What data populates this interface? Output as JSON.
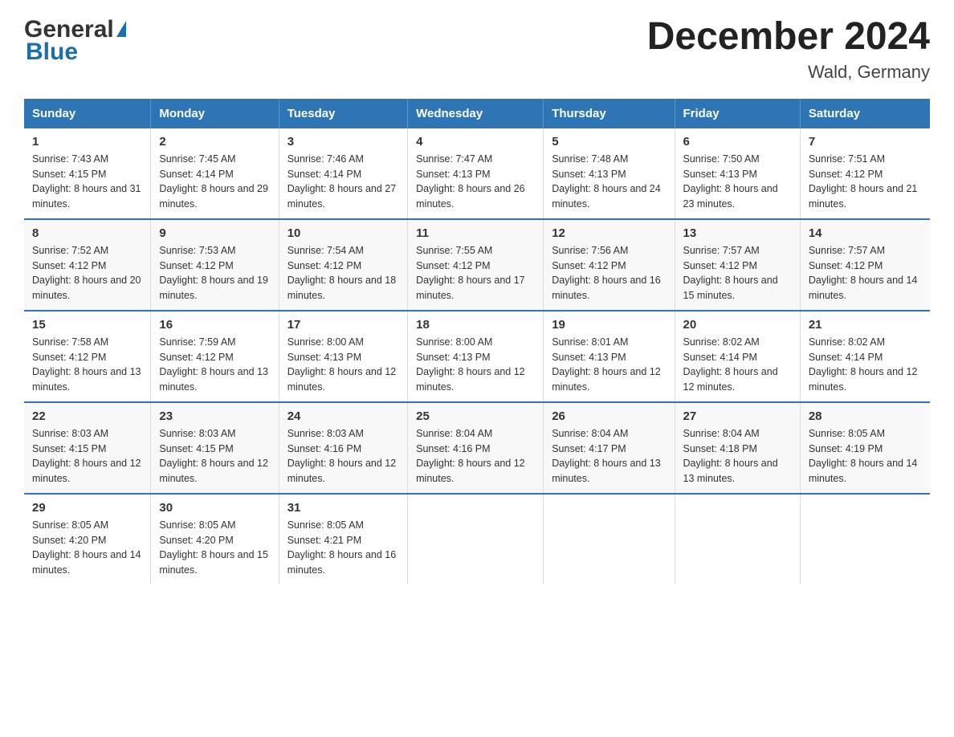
{
  "logo": {
    "general": "General",
    "blue": "Blue"
  },
  "title": "December 2024",
  "subtitle": "Wald, Germany",
  "days_of_week": [
    "Sunday",
    "Monday",
    "Tuesday",
    "Wednesday",
    "Thursday",
    "Friday",
    "Saturday"
  ],
  "weeks": [
    [
      {
        "date": "1",
        "sunrise": "7:43 AM",
        "sunset": "4:15 PM",
        "daylight": "8 hours and 31 minutes."
      },
      {
        "date": "2",
        "sunrise": "7:45 AM",
        "sunset": "4:14 PM",
        "daylight": "8 hours and 29 minutes."
      },
      {
        "date": "3",
        "sunrise": "7:46 AM",
        "sunset": "4:14 PM",
        "daylight": "8 hours and 27 minutes."
      },
      {
        "date": "4",
        "sunrise": "7:47 AM",
        "sunset": "4:13 PM",
        "daylight": "8 hours and 26 minutes."
      },
      {
        "date": "5",
        "sunrise": "7:48 AM",
        "sunset": "4:13 PM",
        "daylight": "8 hours and 24 minutes."
      },
      {
        "date": "6",
        "sunrise": "7:50 AM",
        "sunset": "4:13 PM",
        "daylight": "8 hours and 23 minutes."
      },
      {
        "date": "7",
        "sunrise": "7:51 AM",
        "sunset": "4:12 PM",
        "daylight": "8 hours and 21 minutes."
      }
    ],
    [
      {
        "date": "8",
        "sunrise": "7:52 AM",
        "sunset": "4:12 PM",
        "daylight": "8 hours and 20 minutes."
      },
      {
        "date": "9",
        "sunrise": "7:53 AM",
        "sunset": "4:12 PM",
        "daylight": "8 hours and 19 minutes."
      },
      {
        "date": "10",
        "sunrise": "7:54 AM",
        "sunset": "4:12 PM",
        "daylight": "8 hours and 18 minutes."
      },
      {
        "date": "11",
        "sunrise": "7:55 AM",
        "sunset": "4:12 PM",
        "daylight": "8 hours and 17 minutes."
      },
      {
        "date": "12",
        "sunrise": "7:56 AM",
        "sunset": "4:12 PM",
        "daylight": "8 hours and 16 minutes."
      },
      {
        "date": "13",
        "sunrise": "7:57 AM",
        "sunset": "4:12 PM",
        "daylight": "8 hours and 15 minutes."
      },
      {
        "date": "14",
        "sunrise": "7:57 AM",
        "sunset": "4:12 PM",
        "daylight": "8 hours and 14 minutes."
      }
    ],
    [
      {
        "date": "15",
        "sunrise": "7:58 AM",
        "sunset": "4:12 PM",
        "daylight": "8 hours and 13 minutes."
      },
      {
        "date": "16",
        "sunrise": "7:59 AM",
        "sunset": "4:12 PM",
        "daylight": "8 hours and 13 minutes."
      },
      {
        "date": "17",
        "sunrise": "8:00 AM",
        "sunset": "4:13 PM",
        "daylight": "8 hours and 12 minutes."
      },
      {
        "date": "18",
        "sunrise": "8:00 AM",
        "sunset": "4:13 PM",
        "daylight": "8 hours and 12 minutes."
      },
      {
        "date": "19",
        "sunrise": "8:01 AM",
        "sunset": "4:13 PM",
        "daylight": "8 hours and 12 minutes."
      },
      {
        "date": "20",
        "sunrise": "8:02 AM",
        "sunset": "4:14 PM",
        "daylight": "8 hours and 12 minutes."
      },
      {
        "date": "21",
        "sunrise": "8:02 AM",
        "sunset": "4:14 PM",
        "daylight": "8 hours and 12 minutes."
      }
    ],
    [
      {
        "date": "22",
        "sunrise": "8:03 AM",
        "sunset": "4:15 PM",
        "daylight": "8 hours and 12 minutes."
      },
      {
        "date": "23",
        "sunrise": "8:03 AM",
        "sunset": "4:15 PM",
        "daylight": "8 hours and 12 minutes."
      },
      {
        "date": "24",
        "sunrise": "8:03 AM",
        "sunset": "4:16 PM",
        "daylight": "8 hours and 12 minutes."
      },
      {
        "date": "25",
        "sunrise": "8:04 AM",
        "sunset": "4:16 PM",
        "daylight": "8 hours and 12 minutes."
      },
      {
        "date": "26",
        "sunrise": "8:04 AM",
        "sunset": "4:17 PM",
        "daylight": "8 hours and 13 minutes."
      },
      {
        "date": "27",
        "sunrise": "8:04 AM",
        "sunset": "4:18 PM",
        "daylight": "8 hours and 13 minutes."
      },
      {
        "date": "28",
        "sunrise": "8:05 AM",
        "sunset": "4:19 PM",
        "daylight": "8 hours and 14 minutes."
      }
    ],
    [
      {
        "date": "29",
        "sunrise": "8:05 AM",
        "sunset": "4:20 PM",
        "daylight": "8 hours and 14 minutes."
      },
      {
        "date": "30",
        "sunrise": "8:05 AM",
        "sunset": "4:20 PM",
        "daylight": "8 hours and 15 minutes."
      },
      {
        "date": "31",
        "sunrise": "8:05 AM",
        "sunset": "4:21 PM",
        "daylight": "8 hours and 16 minutes."
      },
      null,
      null,
      null,
      null
    ]
  ],
  "labels": {
    "sunrise": "Sunrise:",
    "sunset": "Sunset:",
    "daylight": "Daylight:"
  }
}
